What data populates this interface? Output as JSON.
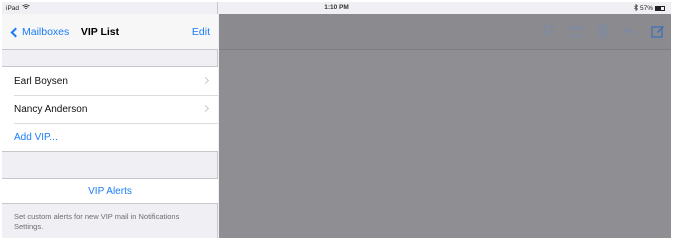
{
  "status_bar": {
    "carrier": "iPad",
    "time": "1:10 PM",
    "battery_text": "57%",
    "battery_level": 0.57
  },
  "nav": {
    "back_label": "Mailboxes",
    "title": "VIP List",
    "edit_label": "Edit"
  },
  "vip_list": {
    "items": [
      {
        "label": "Earl Boysen"
      },
      {
        "label": "Nancy Anderson"
      }
    ],
    "add_label": "Add VIP..."
  },
  "alerts": {
    "label": "VIP Alerts",
    "note": "Set custom alerts for new VIP mail in Notifications Settings."
  },
  "toolbar": {
    "icons": [
      "flag-icon",
      "folder-icon",
      "trash-icon",
      "reply-icon",
      "compose-icon"
    ]
  },
  "colors": {
    "accent": "#1a7cf5",
    "overlay": "#8e8e93"
  }
}
